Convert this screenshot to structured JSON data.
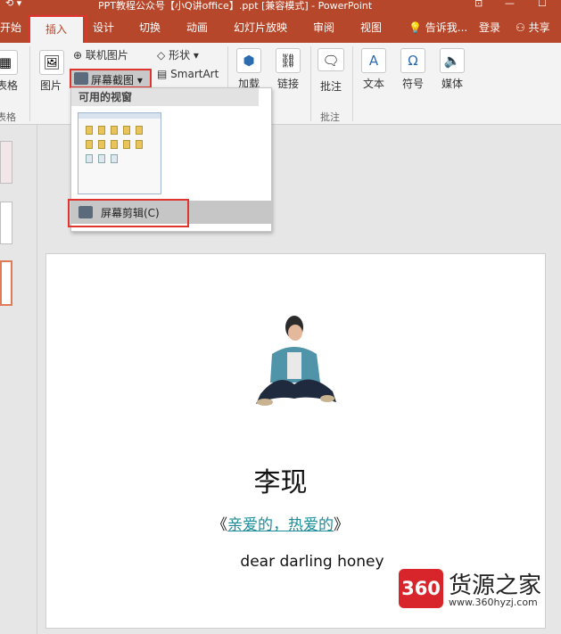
{
  "window": {
    "title": "PPT教程公众号【小Q讲office】.ppt [兼容模式] - PowerPoint",
    "quick_access": "⟲ ▾",
    "controls": [
      "⊡",
      "—",
      "☐"
    ]
  },
  "tabs": [
    {
      "label": "开始"
    },
    {
      "label": "插入"
    },
    {
      "label": "设计"
    },
    {
      "label": "切换"
    },
    {
      "label": "动画"
    },
    {
      "label": "幻灯片放映"
    },
    {
      "label": "审阅"
    },
    {
      "label": "视图"
    }
  ],
  "tell_me": "告诉我...",
  "login": "登录",
  "share": "共享",
  "ribbon": {
    "table_label": "表格",
    "table_group": "表格",
    "picture_label": "图片",
    "online_picture": "联机图片",
    "screenshot": "屏幕截图 ▾",
    "shapes": "形状 ▾",
    "smartart": "SmartArt",
    "addins": "加载",
    "link": "链接",
    "comment": "批注",
    "comment_group": "批注",
    "text": "文本",
    "symbol": "符号",
    "media": "媒体"
  },
  "dropdown": {
    "header": "可用的视窗",
    "clip_item": "屏幕剪辑(C)"
  },
  "slide": {
    "name": "李现",
    "song_open": "《",
    "song_link": "亲爱的，热爱的",
    "song_close": "》",
    "english": "dear darling honey"
  },
  "watermark": {
    "logo": "360",
    "brand": "货源之家",
    "url": "www.360hyzj.com"
  }
}
